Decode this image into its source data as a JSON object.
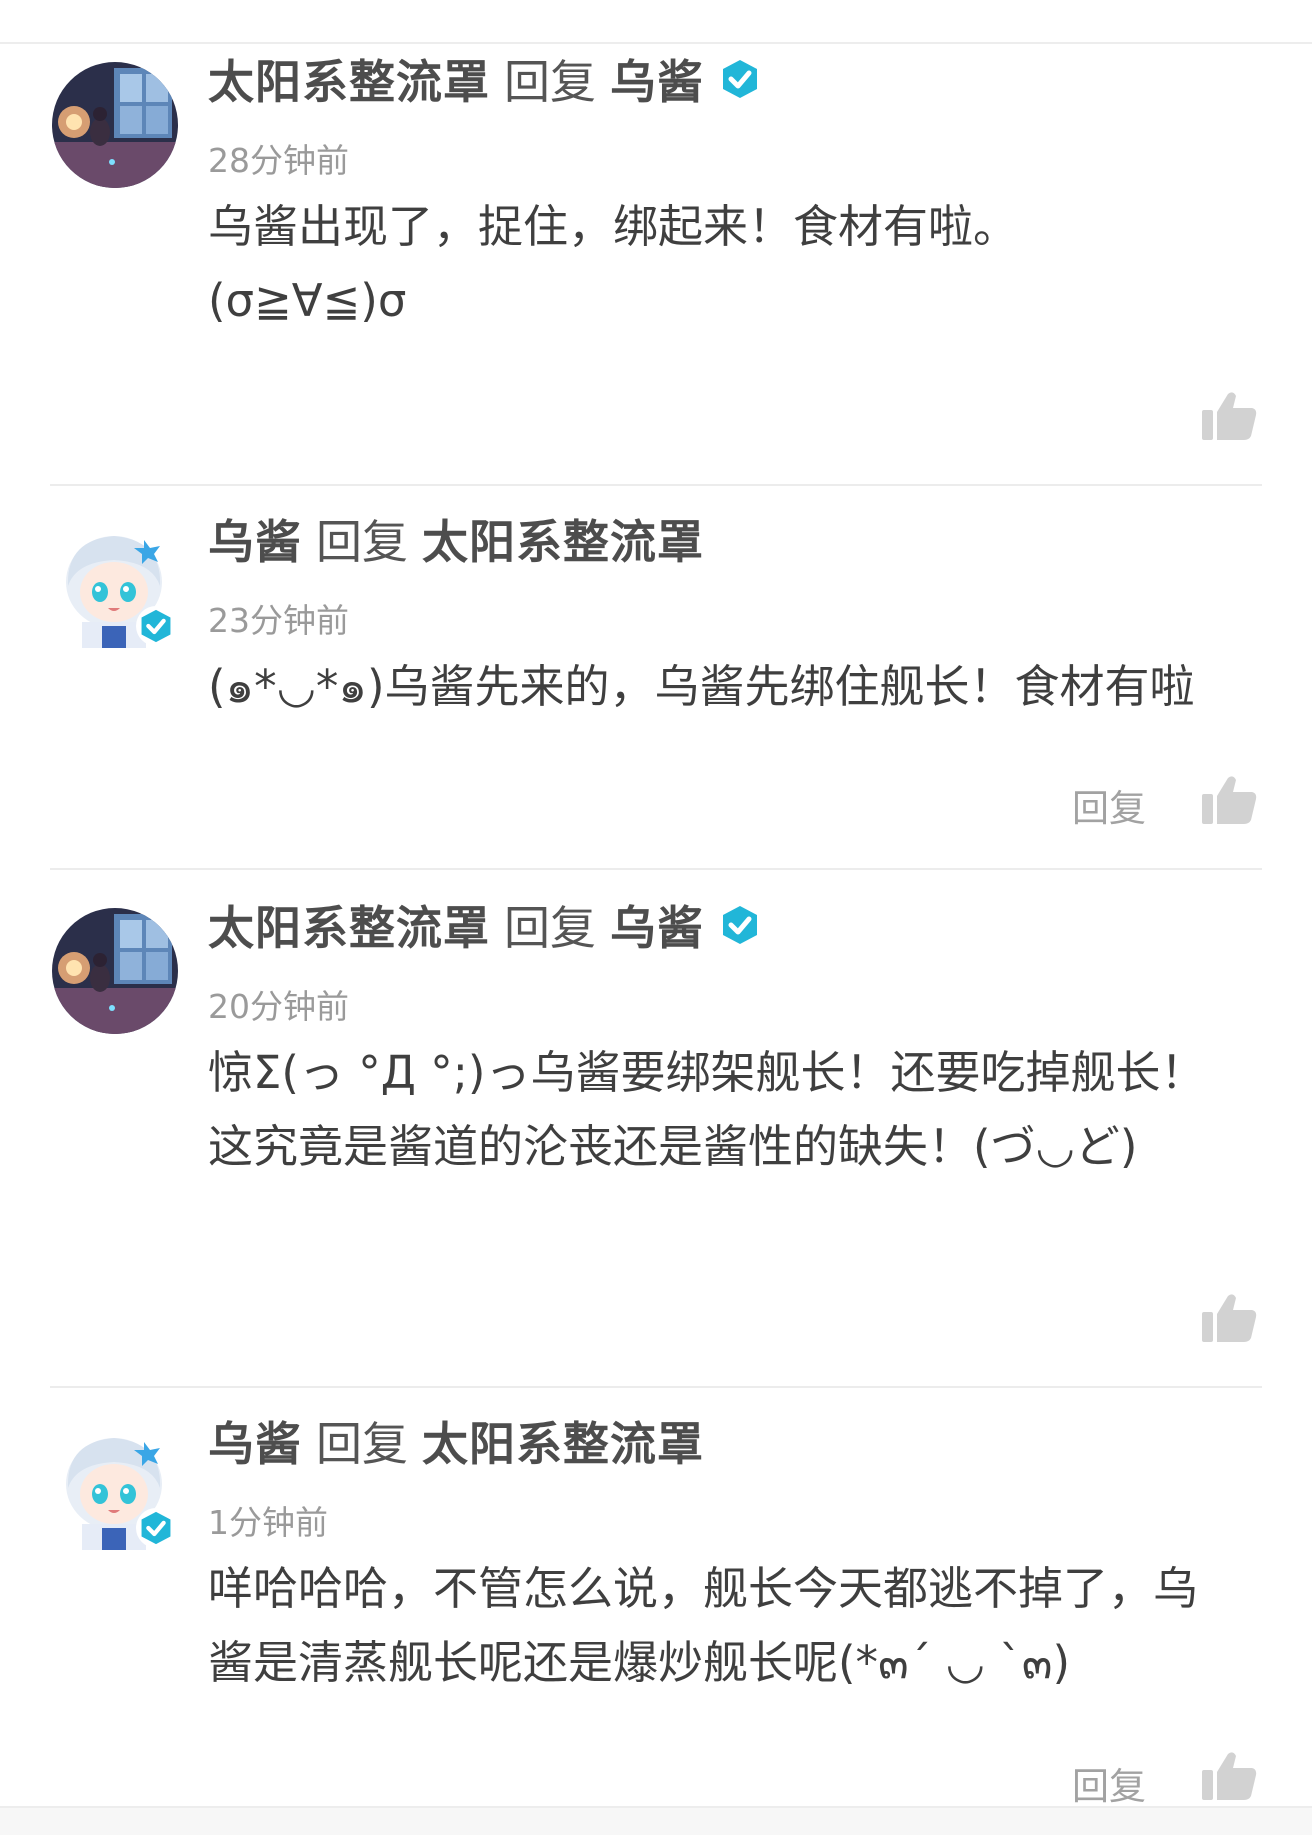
{
  "colors": {
    "verified_badge": "#21b6d8",
    "like_icon": "#d2d2d2",
    "divider": "#ececec"
  },
  "comments": [
    {
      "author": "太阳系整流罩",
      "reply_word": "回复",
      "target": "乌酱",
      "time": "28分钟前",
      "lines": [
        "乌酱出现了，捉住，绑起来！食材有啦。",
        "(σ≧∀≦)σ"
      ]
    },
    {
      "author": "乌酱",
      "reply_word": "回复",
      "target": "太阳系整流罩",
      "time": "23分钟前",
      "lines": [
        "(๑*◡*๑)乌酱先来的，乌酱先绑住舰长！食材有啦"
      ],
      "reply_label": "回复"
    },
    {
      "author": "太阳系整流罩",
      "reply_word": "回复",
      "target": "乌酱",
      "time": "20分钟前",
      "lines": [
        "惊Σ(っ °Д °;)っ乌酱要绑架舰长！还要吃掉舰长！",
        "这究竟是酱道的沦丧还是酱性的缺失！(づ◡ど)"
      ]
    },
    {
      "author": "乌酱",
      "reply_word": "回复",
      "target": "太阳系整流罩",
      "time": "1分钟前",
      "lines": [
        "咩哈哈哈，不管怎么说，舰长今天都逃不掉了，乌",
        "酱是清蒸舰长呢还是爆炒舰长呢(*๓´ ◡ `๓)"
      ],
      "reply_label": "回复"
    }
  ]
}
